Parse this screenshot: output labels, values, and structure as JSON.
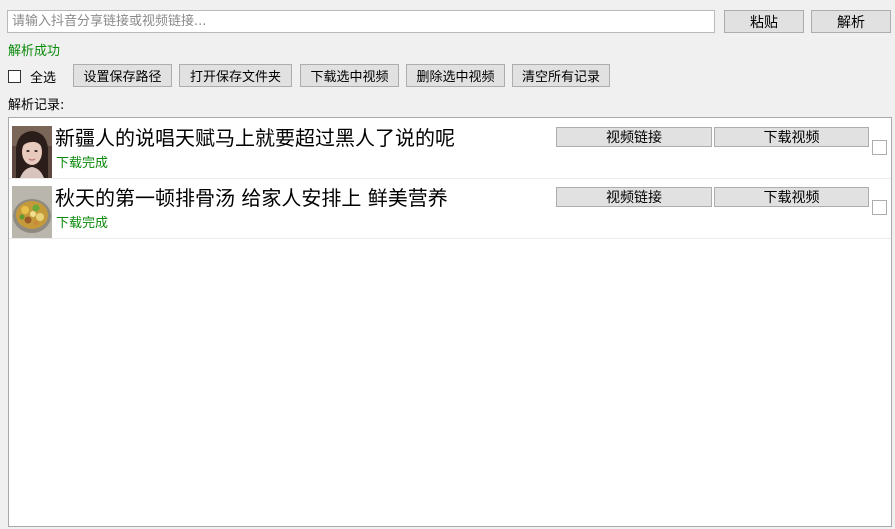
{
  "search": {
    "placeholder": "请输入抖音分享链接或视频链接...",
    "value": ""
  },
  "toolbar": {
    "paste_label": "粘贴",
    "parse_label": "解析"
  },
  "status": {
    "text": "解析成功",
    "color": "#0a8a0a"
  },
  "actions": {
    "select_all_label": "全选",
    "set_path_label": "设置保存路径",
    "open_folder_label": "打开保存文件夹",
    "download_selected_label": "下载选中视频",
    "delete_selected_label": "删除选中视频",
    "clear_all_label": "清空所有记录"
  },
  "records": {
    "label": "解析记录:",
    "items": [
      {
        "title": "新疆人的说唱天赋马上就要超过黑人了说的呢",
        "status": "下载完成",
        "link_label": "视频链接",
        "download_label": "下载视频",
        "thumb_icon": "girl-portrait-thumbnail"
      },
      {
        "title": "秋天的第一顿排骨汤 给家人安排上 鲜美营养",
        "status": "下载完成",
        "link_label": "视频链接",
        "download_label": "下载视频",
        "thumb_icon": "soup-bowl-thumbnail"
      }
    ]
  }
}
